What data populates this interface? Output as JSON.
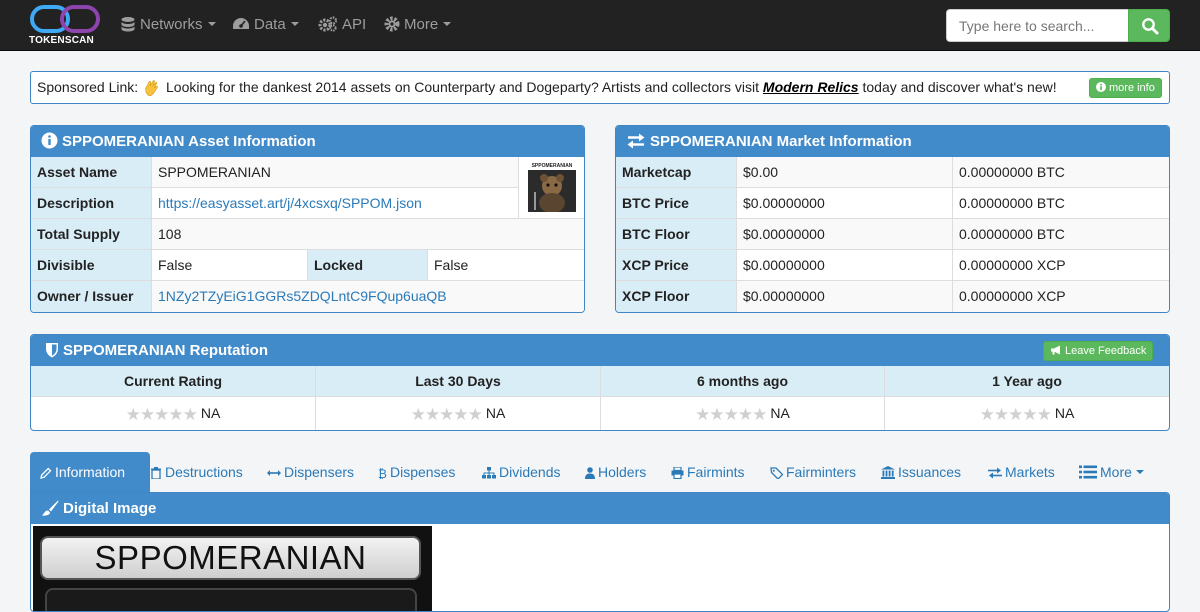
{
  "nav": {
    "brand": "TOKENSCAN",
    "items": [
      {
        "label": "Networks",
        "icon": "database-icon",
        "dropdown": true
      },
      {
        "label": "Data",
        "icon": "dashboard-icon",
        "dropdown": true
      },
      {
        "label": "API",
        "icon": "cogs-icon",
        "dropdown": false
      },
      {
        "label": "More",
        "icon": "gear-icon",
        "dropdown": true
      }
    ],
    "search_placeholder": "Type here to search..."
  },
  "sponsor": {
    "label": "Sponsored Link:",
    "text_before": "Looking for the dankest 2014 assets on Counterparty and Dogeparty? Artists and collectors visit",
    "link_text": "Modern Relics",
    "text_after": "today and discover what's new!",
    "button": "more info"
  },
  "asset_info": {
    "title": "SPPOMERANIAN Asset Information",
    "thumb_caption": "SPPOMERANIAN",
    "rows": {
      "asset_name": {
        "label": "Asset Name",
        "value": "SPPOMERANIAN"
      },
      "description": {
        "label": "Description",
        "value": "https://easyasset.art/j/4xcsxq/SPPOM.json"
      },
      "total_supply": {
        "label": "Total Supply",
        "value": "108"
      },
      "divisible": {
        "label": "Divisible",
        "value": "False"
      },
      "locked": {
        "label": "Locked",
        "value": "False"
      },
      "owner": {
        "label": "Owner / Issuer",
        "value": "1NZy2TZyEiG1GGRs5ZDQLntC9FQup6uaQB"
      }
    }
  },
  "market_info": {
    "title": "SPPOMERANIAN Market Information",
    "rows": [
      {
        "label": "Marketcap",
        "usd": "$0.00",
        "native": "0.00000000 BTC"
      },
      {
        "label": "BTC Price",
        "usd": "$0.00000000",
        "native": "0.00000000 BTC"
      },
      {
        "label": "BTC Floor",
        "usd": "$0.00000000",
        "native": "0.00000000 BTC"
      },
      {
        "label": "XCP Price",
        "usd": "$0.00000000",
        "native": "0.00000000 XCP"
      },
      {
        "label": "XCP Floor",
        "usd": "$0.00000000",
        "native": "0.00000000 XCP"
      }
    ]
  },
  "reputation": {
    "title": "SPPOMERANIAN Reputation",
    "feedback_button": "Leave Feedback",
    "columns": [
      {
        "title": "Current Rating",
        "value": "NA",
        "stars": 0
      },
      {
        "title": "Last 30 Days",
        "value": "NA",
        "stars": 0
      },
      {
        "title": "6 months ago",
        "value": "NA",
        "stars": 0
      },
      {
        "title": "1 Year ago",
        "value": "NA",
        "stars": 0
      }
    ]
  },
  "tabs": [
    {
      "label": "Information",
      "icon": "pencil-icon",
      "active": true
    },
    {
      "label": "Destructions",
      "icon": "trash-icon"
    },
    {
      "label": "Dispensers",
      "icon": "arrows-h-icon"
    },
    {
      "label": "Dispenses",
      "icon": "bitcoin-icon"
    },
    {
      "label": "Dividends",
      "icon": "sitemap-icon"
    },
    {
      "label": "Holders",
      "icon": "user-icon"
    },
    {
      "label": "Fairmints",
      "icon": "print-icon"
    },
    {
      "label": "Fairminters",
      "icon": "tag-icon"
    },
    {
      "label": "Issuances",
      "icon": "bank-icon"
    },
    {
      "label": "Markets",
      "icon": "exchange-icon"
    },
    {
      "label": "More",
      "icon": "list-icon",
      "dropdown": true
    }
  ],
  "digital_image": {
    "title": "Digital Image",
    "image_text": "SPPOMERANIAN"
  },
  "colors": {
    "navbar": "#222222",
    "panel_blue": "#428bca",
    "header_cell": "#d9edf7",
    "link": "#2a7ab8",
    "green": "#5cb85c"
  }
}
